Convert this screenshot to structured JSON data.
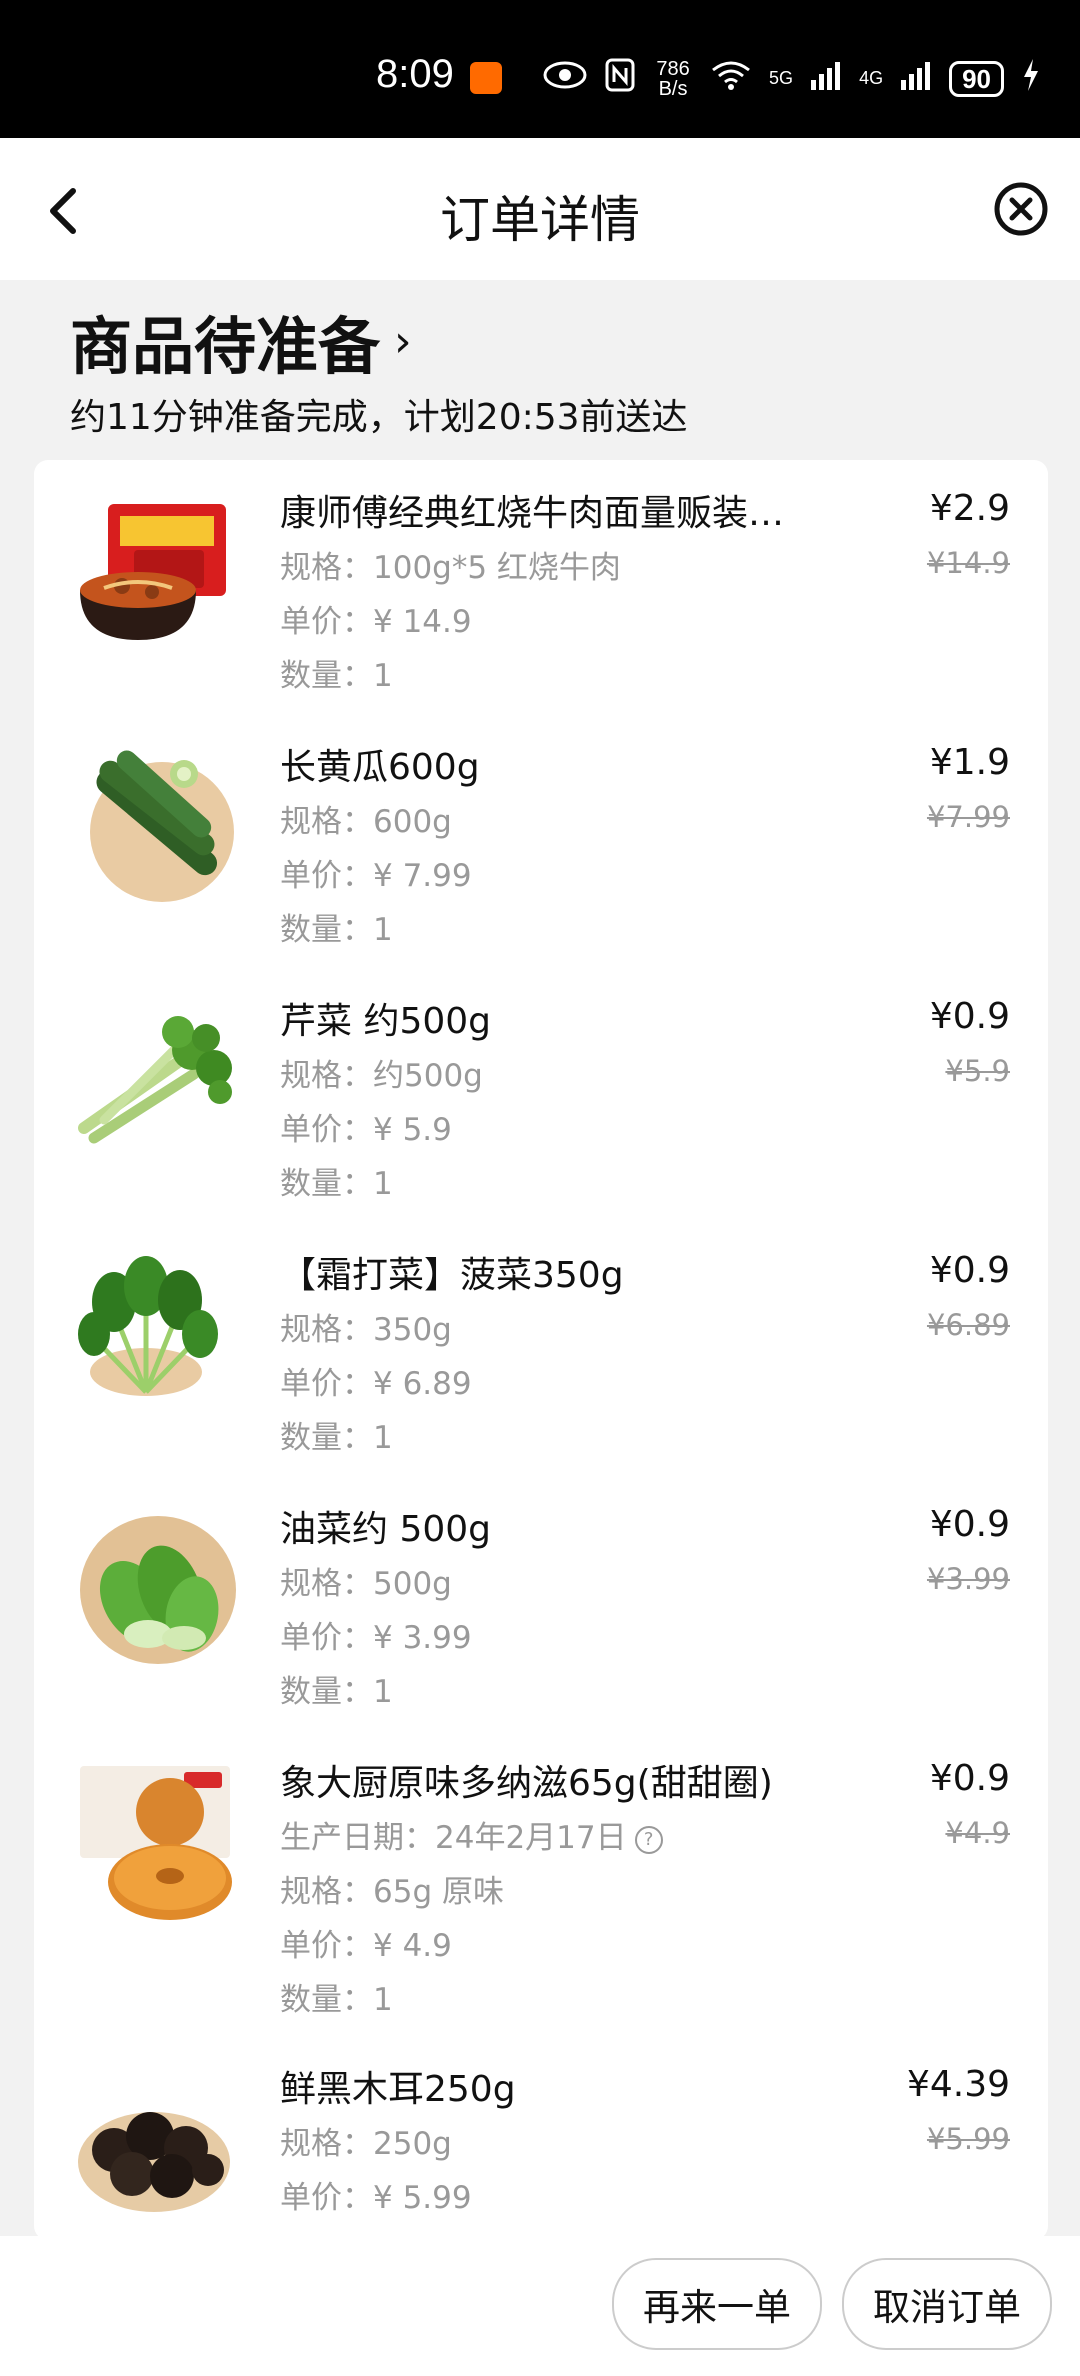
{
  "status_bar": {
    "time": "8:09",
    "net_speed": "786 B/s",
    "signal_5g": "5G",
    "signal_4g": "4G",
    "battery": "90"
  },
  "nav": {
    "title": "订单详情"
  },
  "order_status": {
    "heading": "商品待准备",
    "subtitle": "约11分钟准备完成，计划20:53前送达"
  },
  "items": [
    {
      "name": "康师傅经典红烧牛肉面量贩装…",
      "spec": "规格：100g*5 红烧牛肉",
      "unit_price": "单价：¥ 14.9",
      "qty": "数量：1",
      "price": "¥2.9",
      "orig_price": "¥14.9"
    },
    {
      "name": "长黄瓜600g",
      "spec": "规格：600g",
      "unit_price": "单价：¥ 7.99",
      "qty": "数量：1",
      "price": "¥1.9",
      "orig_price": "¥7.99"
    },
    {
      "name": "芹菜 约500g",
      "spec": "规格：约500g",
      "unit_price": "单价：¥ 5.9",
      "qty": "数量：1",
      "price": "¥0.9",
      "orig_price": "¥5.9"
    },
    {
      "name": "【霜打菜】菠菜350g",
      "spec": "规格：350g",
      "unit_price": "单价：¥ 6.89",
      "qty": "数量：1",
      "price": "¥0.9",
      "orig_price": "¥6.89"
    },
    {
      "name": "油菜约 500g",
      "spec": "规格：500g",
      "unit_price": "单价：¥ 3.99",
      "qty": "数量：1",
      "price": "¥0.9",
      "orig_price": "¥3.99"
    },
    {
      "name": "象大厨原味多纳滋65g(甜甜圈)",
      "production_date": "生产日期：24年2月17日",
      "spec": "规格：65g 原味",
      "unit_price": "单价：¥ 4.9",
      "qty": "数量：1",
      "price": "¥0.9",
      "orig_price": "¥4.9"
    },
    {
      "name": "鲜黑木耳250g",
      "spec": "规格：250g",
      "unit_price": "单价：¥ 5.99",
      "price": "¥4.39",
      "orig_price": "¥5.99"
    }
  ],
  "actions": {
    "reorder": "再来一单",
    "cancel": "取消订单"
  },
  "colors": {
    "status_bar_bg": "#000000",
    "page_bg": "#f2f2f2",
    "card_bg": "#ffffff",
    "primary_text": "#111111",
    "secondary_text": "#999999",
    "app_badge": "#ff6a00"
  }
}
